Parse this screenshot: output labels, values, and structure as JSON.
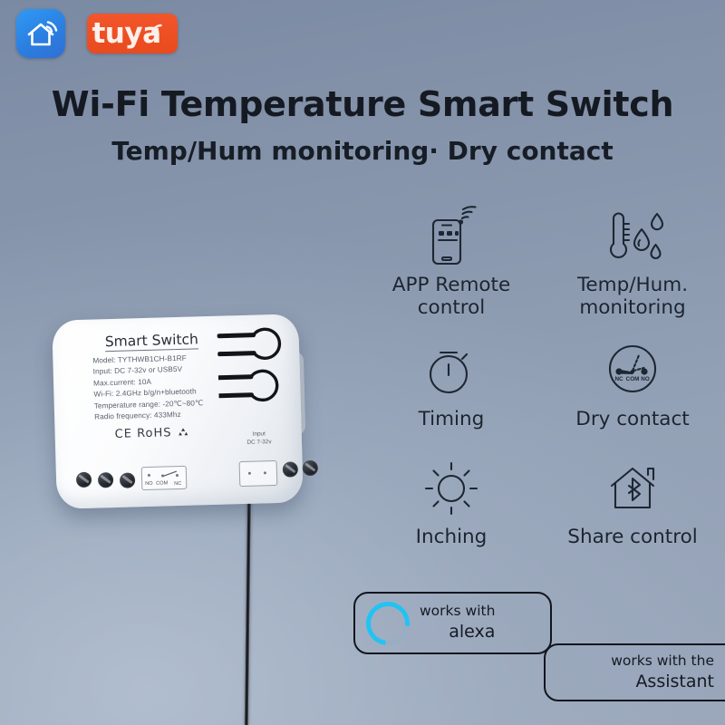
{
  "brand_logos": {
    "smart_life": {
      "icon": "smart-home-house-wifi-icon",
      "color": "#2b7fe0",
      "alt": "Smart Life"
    },
    "tuya": {
      "text": "tuya",
      "icon": "wifi-arc-icon",
      "color": "#ea4c1f"
    }
  },
  "headings": {
    "title": "Wi-Fi Temperature Smart Switch",
    "subtitle": "Temp/Hum monitoring·  Dry contact"
  },
  "features": [
    {
      "icon": "phone-wifi-icon",
      "label_line1": "APP Remote",
      "label_line2": "control"
    },
    {
      "icon": "thermometer-droplets-icon",
      "label_line1": "Temp/Hum.",
      "label_line2": "monitoring"
    },
    {
      "icon": "stopwatch-icon",
      "label_line1": "Timing",
      "label_line2": ""
    },
    {
      "icon": "relay-contact-icon",
      "label_line1": "Dry contact",
      "label_line2": ""
    },
    {
      "icon": "sun-brightness-icon",
      "label_line1": "Inching",
      "label_line2": ""
    },
    {
      "icon": "house-bluetooth-icon",
      "label_line1": "Share control",
      "label_line2": ""
    }
  ],
  "device": {
    "title": "Smart Switch",
    "specs": [
      "Model: TYTHWB1CH-B1RF",
      "Input: DC 7-32v or USB5V",
      "Max.current: 10A",
      "Wi-Fi: 2.4GHz b/g/n+bluetooth",
      "Temperature range: -20℃~80℃",
      "Radio frequency: 433Mhz"
    ],
    "certification": "CE RoHS",
    "recycle_icon": "recycle-icon",
    "terminal_labels": [
      "NO",
      "COM",
      "NC"
    ],
    "input_label_line1": "Input",
    "input_label_line2": "DC 7-32v"
  },
  "badges": [
    {
      "name": "alexa",
      "icon": "alexa-ring-icon",
      "line1": "works with",
      "line2": "alexa",
      "icon_color": "#22c3f3"
    },
    {
      "name": "google-assistant",
      "icon": "",
      "line1": "works with the",
      "line2": "Assistant"
    }
  ]
}
